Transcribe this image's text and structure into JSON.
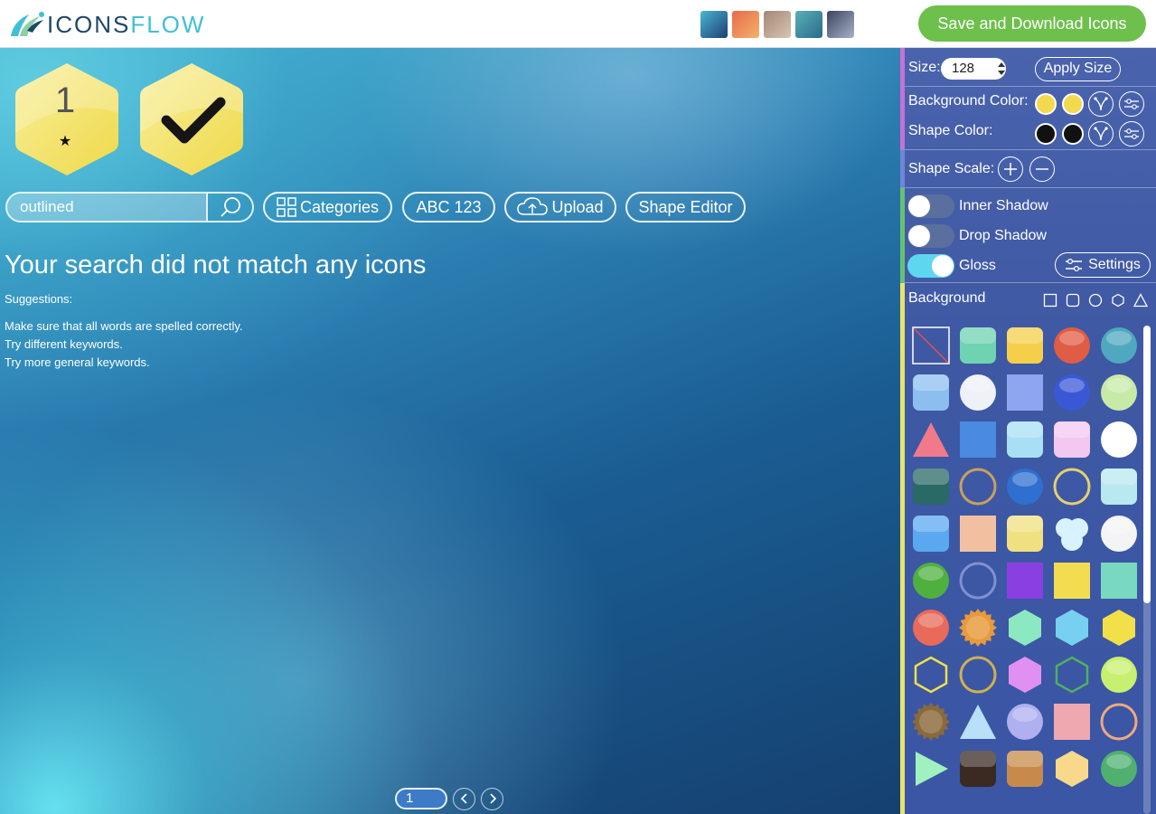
{
  "header": {
    "logo_text_dark": "ICONS",
    "logo_text_light": "FLOW",
    "save_button": "Save and Download Icons",
    "theme_swatches": [
      "theme-ocean",
      "theme-sunset",
      "theme-sand",
      "theme-lagoon",
      "theme-slate"
    ]
  },
  "preview": {
    "number_badge": "1",
    "star_badge": "★",
    "badge_color": "#f2e06a"
  },
  "toolbar": {
    "search_value": "outlined",
    "categories_label": "Categories",
    "abc_label": "ABC 123",
    "upload_label": "Upload",
    "shape_editor_label": "Shape Editor"
  },
  "results": {
    "no_match": "Your search did not match any icons",
    "suggestions_title": "Suggestions:",
    "suggestions": [
      "Make sure that all words are spelled correctly.",
      "Try different keywords.",
      "Try more general keywords."
    ]
  },
  "pager": {
    "page": "1"
  },
  "panel": {
    "size_label": "Size:",
    "size_value": "128",
    "apply_size": "Apply Size",
    "background_color_label": "Background Color:",
    "shape_color_label": "Shape Color:",
    "shape_scale_label": "Shape Scale:",
    "inner_shadow": {
      "label": "Inner Shadow",
      "on": false
    },
    "drop_shadow": {
      "label": "Drop Shadow",
      "on": false
    },
    "gloss": {
      "label": "Gloss",
      "on": true
    },
    "settings_label": "Settings",
    "background_label": "Background",
    "background_color": "#f2d94e",
    "shape_color": "#111111",
    "accent_colors": [
      "#c770d6",
      "#6f86d6",
      "#67c26f",
      "#e8e36a"
    ],
    "scrollbar_position": 0.0
  }
}
